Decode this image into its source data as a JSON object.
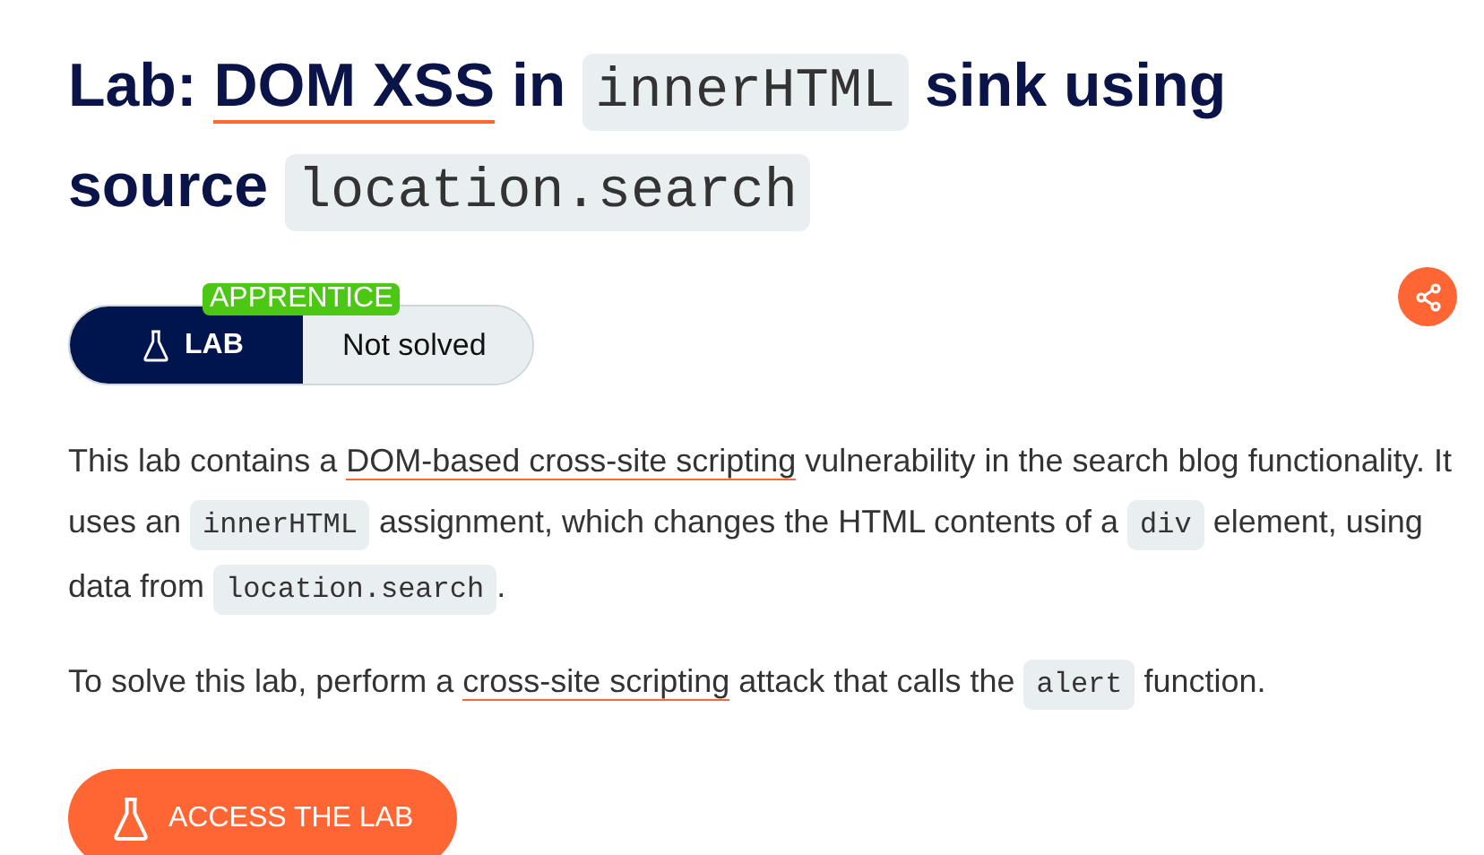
{
  "title": [
    {
      "kind": "text",
      "text": "Lab: "
    },
    {
      "kind": "link",
      "text": "DOM XSS"
    },
    {
      "kind": "text",
      "text": " in "
    },
    {
      "kind": "code",
      "text": "innerHTML"
    },
    {
      "kind": "text",
      "text": " sink using source "
    },
    {
      "kind": "code",
      "text": "location.search"
    }
  ],
  "level_badge": "APPRENTICE",
  "lab_label": "LAB",
  "status": "Not solved",
  "paragraphs": [
    [
      {
        "kind": "text",
        "text": "This lab contains a "
      },
      {
        "kind": "link",
        "text": "DOM-based cross-site scripting"
      },
      {
        "kind": "text",
        "text": " vulnerability in the search blog functionality. It uses an "
      },
      {
        "kind": "code",
        "text": "innerHTML"
      },
      {
        "kind": "text",
        "text": " assignment, which changes the HTML contents of a "
      },
      {
        "kind": "code",
        "text": "div"
      },
      {
        "kind": "text",
        "text": " element, using data from "
      },
      {
        "kind": "code",
        "text": "location.search"
      },
      {
        "kind": "text",
        "text": "."
      }
    ],
    [
      {
        "kind": "text",
        "text": "To solve this lab, perform a "
      },
      {
        "kind": "link",
        "text": "cross-site scripting"
      },
      {
        "kind": "text",
        "text": " attack that calls the "
      },
      {
        "kind": "code",
        "text": "alert"
      },
      {
        "kind": "text",
        "text": " function."
      }
    ]
  ],
  "access_button": "ACCESS THE LAB"
}
